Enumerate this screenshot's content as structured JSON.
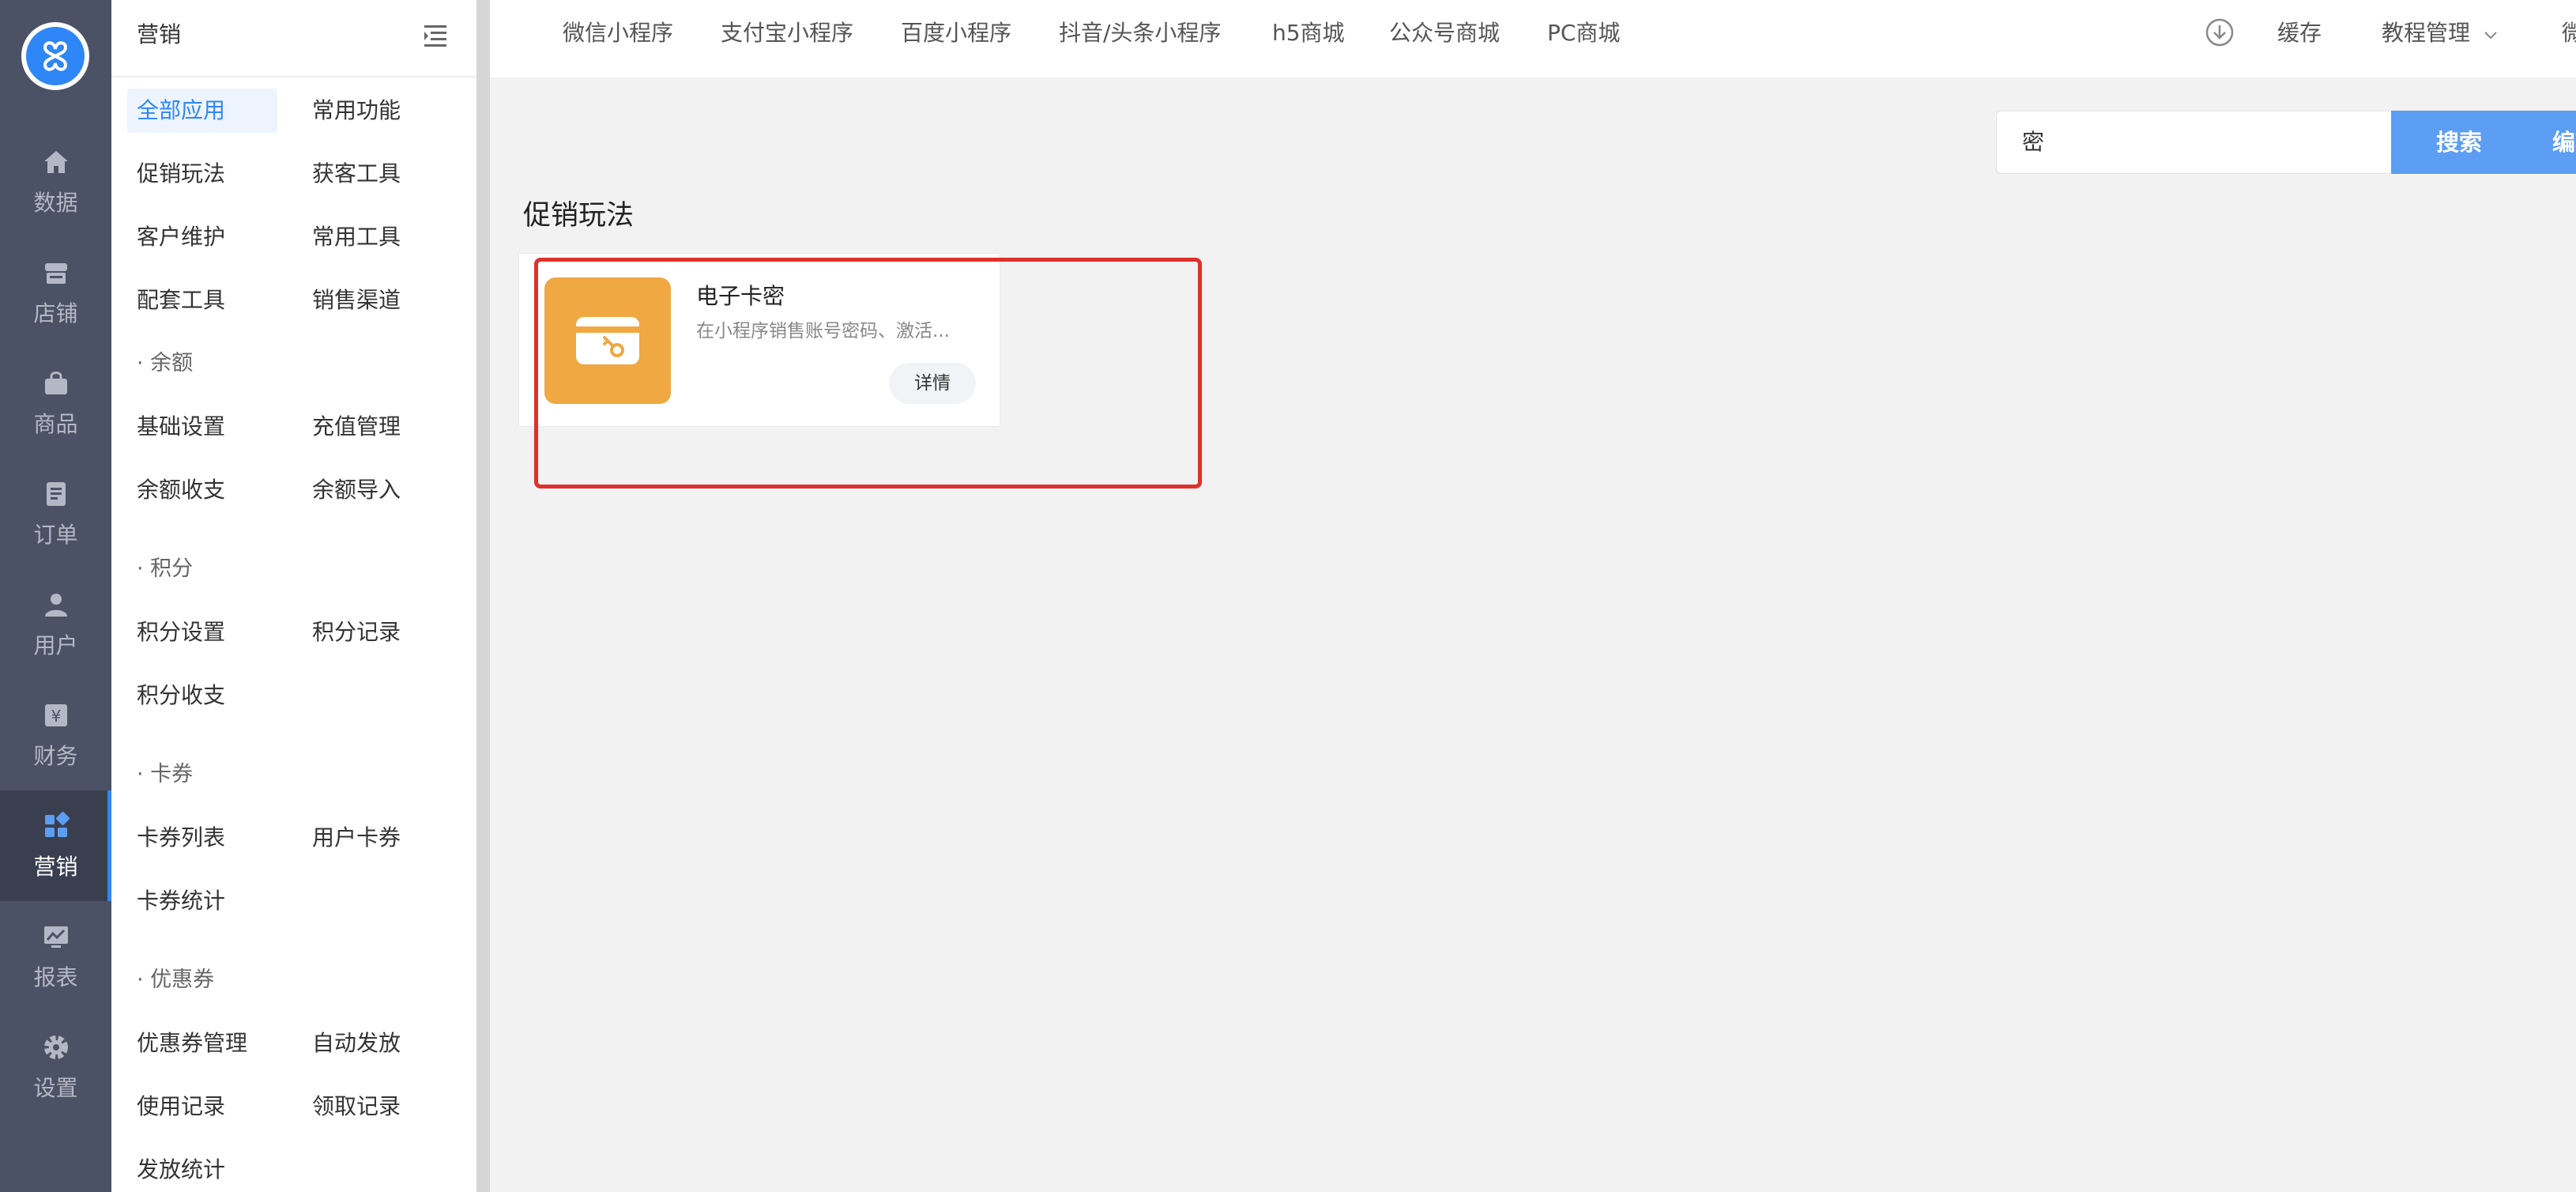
{
  "rail": {
    "items": [
      {
        "label": "数据",
        "icon": "home-icon"
      },
      {
        "label": "店铺",
        "icon": "store-icon"
      },
      {
        "label": "商品",
        "icon": "bag-icon"
      },
      {
        "label": "订单",
        "icon": "order-icon"
      },
      {
        "label": "用户",
        "icon": "user-icon"
      },
      {
        "label": "财务",
        "icon": "yen-icon"
      },
      {
        "label": "营销",
        "icon": "apps-icon",
        "active": true
      },
      {
        "label": "报表",
        "icon": "report-icon"
      },
      {
        "label": "设置",
        "icon": "gear-icon"
      }
    ]
  },
  "submenu": {
    "title": "营销",
    "groups": {
      "all_apps": "全部应用",
      "common_features": "常用功能",
      "promo_play": "促销玩法",
      "acquire_tools": "获客工具",
      "customer_care": "客户维护",
      "common_tools": "常用工具",
      "support_tools": "配套工具",
      "sales_channels": "销售渠道"
    },
    "balance": {
      "section": "余额",
      "items": [
        "基础设置",
        "充值管理",
        "余额收支",
        "余额导入"
      ]
    },
    "points": {
      "section": "积分",
      "items": [
        "积分设置",
        "积分记录",
        "积分收支"
      ]
    },
    "cards": {
      "section": "卡券",
      "items": [
        "卡券列表",
        "用户卡券",
        "卡券统计"
      ]
    },
    "coupons": {
      "section": "优惠券",
      "items": [
        "优惠券管理",
        "自动发放",
        "使用记录",
        "领取记录",
        "发放统计"
      ]
    }
  },
  "topbar": {
    "tabs": [
      "微信小程序",
      "支付宝小程序",
      "百度小程序",
      "抖音/头条小程序",
      "h5商城",
      "公众号商城",
      "PC商城"
    ],
    "cache": "缓存",
    "tutorial": "教程管理",
    "cut_off": "微"
  },
  "search": {
    "value": "密",
    "button": "搜索",
    "edit_button": "编辑"
  },
  "main": {
    "section_title": "促销玩法",
    "card": {
      "name": "电子卡密",
      "desc": "在小程序销售账号密码、激活...",
      "button": "详情"
    }
  },
  "colors": {
    "accent": "#2f86f6",
    "rail": "#4c5265",
    "card_icon": "#f0a843",
    "highlight": "#e0302b"
  }
}
